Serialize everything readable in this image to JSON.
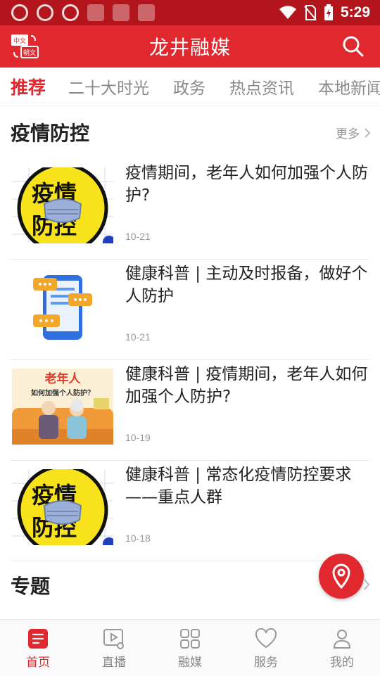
{
  "status_bar": {
    "time": "5:29"
  },
  "header": {
    "title": "龙井融媒",
    "lang_badge_top": "中文",
    "lang_badge_bottom": "朝文"
  },
  "tabs": [
    {
      "label": "推荐",
      "active": true
    },
    {
      "label": "二十大时光",
      "active": false
    },
    {
      "label": "政务",
      "active": false
    },
    {
      "label": "热点资讯",
      "active": false
    },
    {
      "label": "本地新闻",
      "active": false
    }
  ],
  "section": {
    "title": "疫情防控",
    "more": "更多"
  },
  "news": [
    {
      "title": "疫情期间，老年人如何加强个人防护?",
      "date": "10-21",
      "thumb_text_1": "疫情",
      "thumb_text_2": "防控"
    },
    {
      "title": "健康科普 | 主动及时报备，做好个人防护",
      "date": "10-21"
    },
    {
      "title": "健康科普 | 疫情期间，老年人如何加强个人防护?",
      "date": "10-19",
      "thumb_text_1": "老年人",
      "thumb_text_2": "如何加强个人防护？"
    },
    {
      "title": "健康科普 | 常态化疫情防控要求——重点人群",
      "date": "10-18",
      "thumb_text_1": "疫情",
      "thumb_text_2": "防控"
    }
  ],
  "section2": {
    "title": "专题"
  },
  "bottom_nav": [
    {
      "label": "首页",
      "icon": "home-icon",
      "active": true
    },
    {
      "label": "直播",
      "icon": "live-icon",
      "active": false
    },
    {
      "label": "融媒",
      "icon": "grid-icon",
      "active": false
    },
    {
      "label": "服务",
      "icon": "heart-icon",
      "active": false
    },
    {
      "label": "我的",
      "icon": "user-icon",
      "active": false
    }
  ],
  "colors": {
    "brand_red": "#e0282e",
    "status_bar": "#b3151c",
    "yellow": "#f7e21b",
    "text": "#222222",
    "muted": "#999999"
  }
}
